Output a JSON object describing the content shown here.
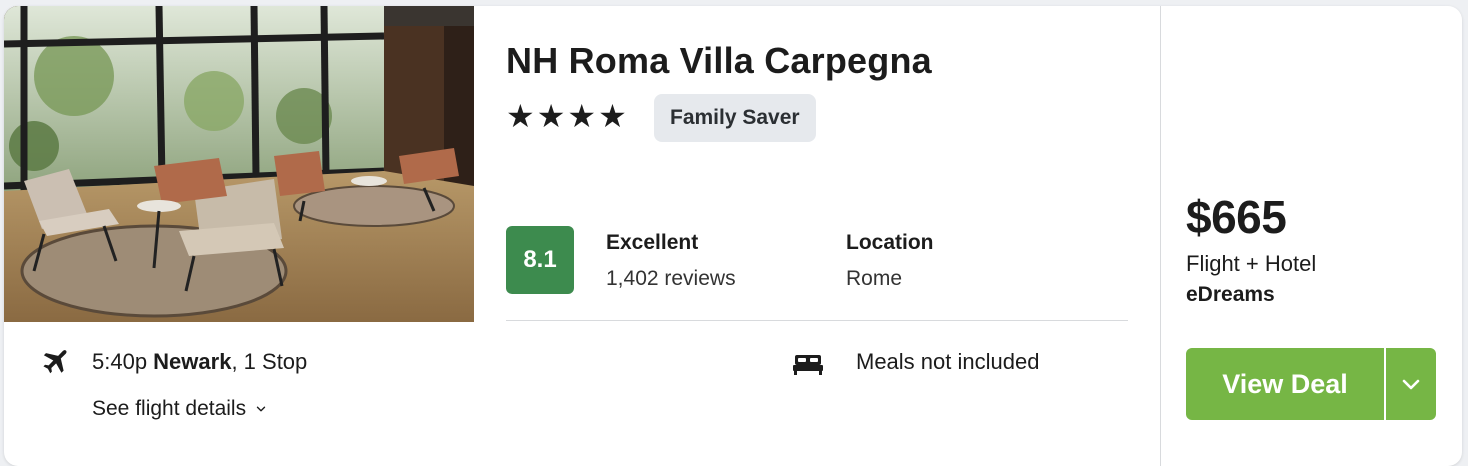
{
  "hotel": {
    "name": "NH Roma Villa Carpegna",
    "stars": "★★★★",
    "star_count": 4,
    "badge": "Family Saver",
    "photo_icon": "hotel-lobby-photo"
  },
  "rating": {
    "score": "8.1",
    "label": "Excellent",
    "reviews": "1,402 reviews",
    "score_color": "#3d8b4e"
  },
  "location": {
    "label": "Location",
    "value": "Rome"
  },
  "flight": {
    "icon": "airplane-icon",
    "time": "5:40p",
    "origin": "Newark",
    "stops": ", 1 Stop",
    "details_link": "See flight details"
  },
  "meals": {
    "icon": "bed-icon",
    "text": "Meals not included"
  },
  "pricing": {
    "price": "$665",
    "package": "Flight + Hotel",
    "provider": "eDreams",
    "cta_label": "View Deal",
    "cta_color": "#76b645"
  }
}
